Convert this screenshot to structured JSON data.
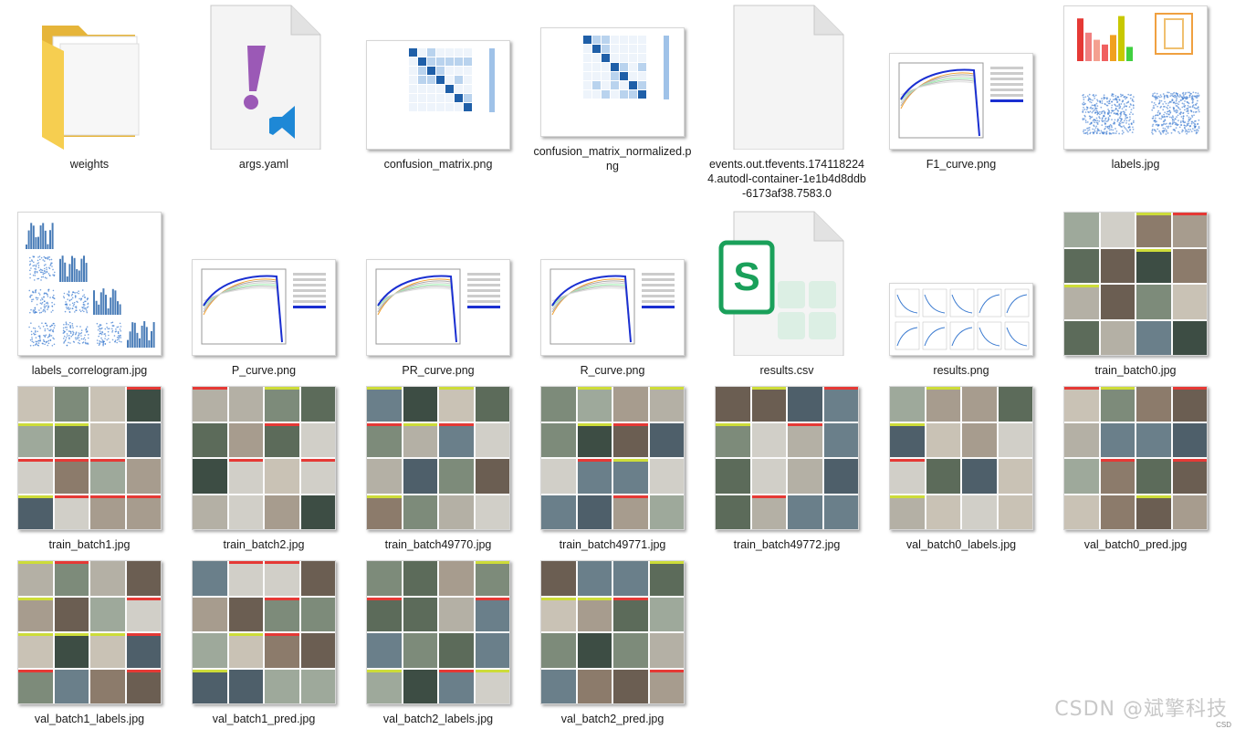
{
  "files": [
    {
      "name": "weights",
      "kind": "folder"
    },
    {
      "name": "args.yaml",
      "kind": "yaml"
    },
    {
      "name": "confusion_matrix.png",
      "kind": "matrix"
    },
    {
      "name": "confusion_matrix_normalized.png",
      "kind": "matrix"
    },
    {
      "name": "events.out.tfevents.1741182244.autodl-container-1e1b4d8ddb-6173af38.7583.0",
      "kind": "blank"
    },
    {
      "name": "F1_curve.png",
      "kind": "curve"
    },
    {
      "name": "labels.jpg",
      "kind": "labels"
    },
    {
      "name": "labels_correlogram.jpg",
      "kind": "correlogram"
    },
    {
      "name": "P_curve.png",
      "kind": "curve"
    },
    {
      "name": "PR_curve.png",
      "kind": "curve"
    },
    {
      "name": "R_curve.png",
      "kind": "curve"
    },
    {
      "name": "results.csv",
      "kind": "csv"
    },
    {
      "name": "results.png",
      "kind": "results"
    },
    {
      "name": "train_batch0.jpg",
      "kind": "mosaic"
    },
    {
      "name": "train_batch1.jpg",
      "kind": "mosaic"
    },
    {
      "name": "train_batch2.jpg",
      "kind": "mosaic"
    },
    {
      "name": "train_batch49770.jpg",
      "kind": "mosaic"
    },
    {
      "name": "train_batch49771.jpg",
      "kind": "mosaic"
    },
    {
      "name": "train_batch49772.jpg",
      "kind": "mosaic"
    },
    {
      "name": "val_batch0_labels.jpg",
      "kind": "mosaic"
    },
    {
      "name": "val_batch0_pred.jpg",
      "kind": "mosaic"
    },
    {
      "name": "val_batch1_labels.jpg",
      "kind": "mosaic"
    },
    {
      "name": "val_batch1_pred.jpg",
      "kind": "mosaic"
    },
    {
      "name": "val_batch2_labels.jpg",
      "kind": "mosaic"
    },
    {
      "name": "val_batch2_pred.jpg",
      "kind": "mosaic"
    }
  ],
  "watermark": "CSDN @斌擎科技",
  "corner_text": "CSD",
  "colors": {
    "folder": "#f5c842",
    "vscode_blue": "#1e88d6",
    "yaml_purple": "#9b59b6",
    "csv_green": "#1aa05a",
    "matrix_blue": "#1f5fa8",
    "curve_blue": "#1a2fd1"
  }
}
